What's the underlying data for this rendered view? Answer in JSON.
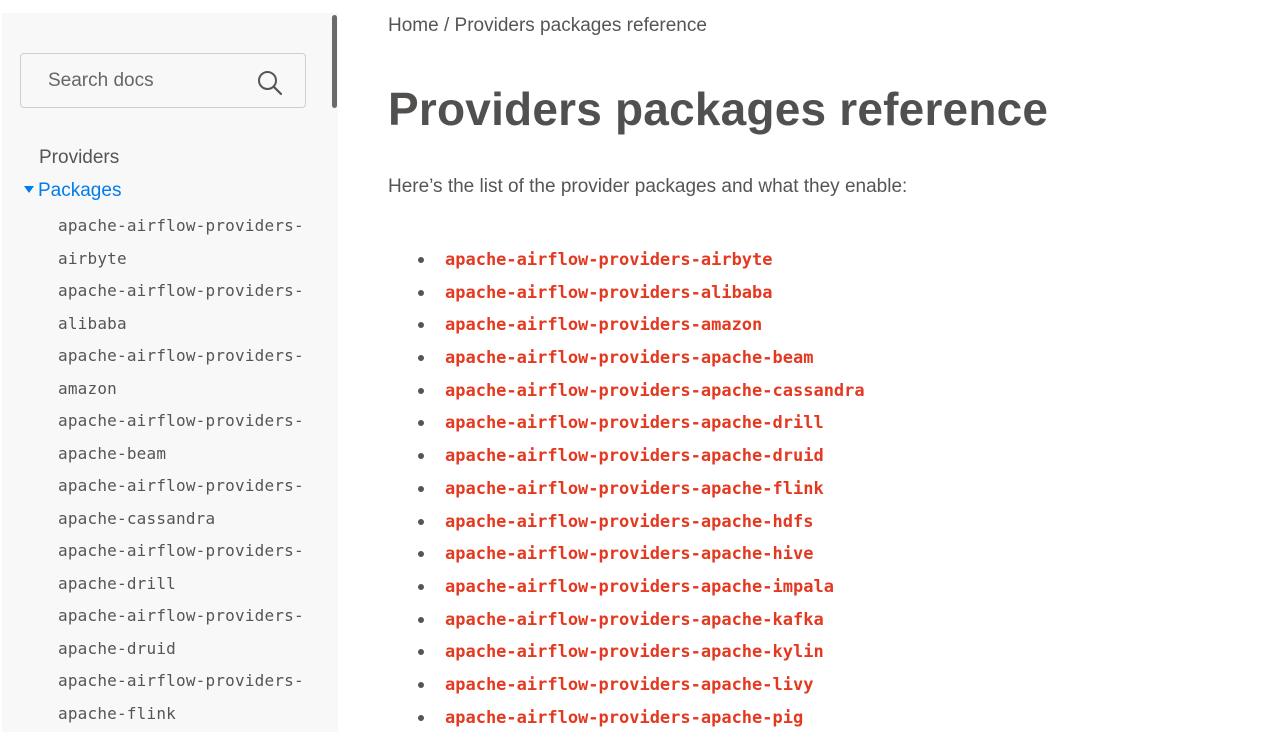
{
  "sidebar": {
    "search": {
      "placeholder": "Search docs"
    },
    "nav": {
      "providers_label": "Providers",
      "packages_label": "Packages",
      "packages": [
        "apache-airflow-providers-airbyte",
        "apache-airflow-providers-alibaba",
        "apache-airflow-providers-amazon",
        "apache-airflow-providers-apache-beam",
        "apache-airflow-providers-apache-cassandra",
        "apache-airflow-providers-apache-drill",
        "apache-airflow-providers-apache-druid",
        "apache-airflow-providers-apache-flink"
      ]
    }
  },
  "main": {
    "breadcrumb": {
      "home": "Home",
      "separator": " / ",
      "current": "Providers packages reference"
    },
    "title": "Providers packages reference",
    "intro": "Here’s the list of the provider packages and what they enable:",
    "packages": [
      "apache-airflow-providers-airbyte",
      "apache-airflow-providers-alibaba",
      "apache-airflow-providers-amazon",
      "apache-airflow-providers-apache-beam",
      "apache-airflow-providers-apache-cassandra",
      "apache-airflow-providers-apache-drill",
      "apache-airflow-providers-apache-druid",
      "apache-airflow-providers-apache-flink",
      "apache-airflow-providers-apache-hdfs",
      "apache-airflow-providers-apache-hive",
      "apache-airflow-providers-apache-impala",
      "apache-airflow-providers-apache-kafka",
      "apache-airflow-providers-apache-kylin",
      "apache-airflow-providers-apache-livy",
      "apache-airflow-providers-apache-pig"
    ]
  },
  "colors": {
    "link": "#e43921",
    "active_nav": "#017cee",
    "text": "#555555",
    "heading": "#51504f",
    "sidebar_bg": "#f8f8f8"
  }
}
